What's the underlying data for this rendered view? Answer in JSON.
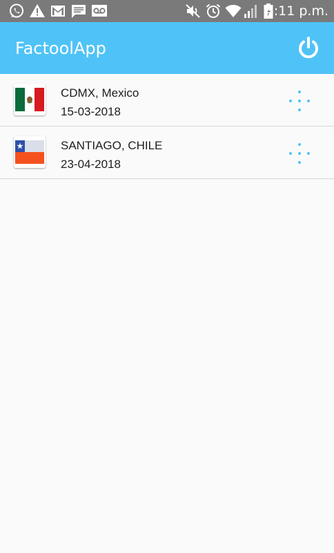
{
  "status_bar": {
    "time": "4:11 p.m.",
    "icons": [
      "whatsapp-icon",
      "warning-icon",
      "gmail-icon",
      "message-icon",
      "voicemail-icon",
      "mute-icon",
      "alarm-icon",
      "wifi-icon",
      "signal-icon",
      "battery-charging-icon"
    ]
  },
  "app_bar": {
    "title": "FactoolApp",
    "power_icon": "power-icon"
  },
  "colors": {
    "status_bar": "#7a7a7a",
    "accent": "#4fc3f7",
    "background": "#fafafa"
  },
  "trips": [
    {
      "location": "CDMX, Mexico",
      "date": "15-03-2018",
      "flag": "mexico-flag-icon",
      "action_icon": "more-dots-icon"
    },
    {
      "location": "SANTIAGO, CHILE",
      "date": "23-04-2018",
      "flag": "chile-flag-icon",
      "action_icon": "more-dots-icon"
    }
  ]
}
